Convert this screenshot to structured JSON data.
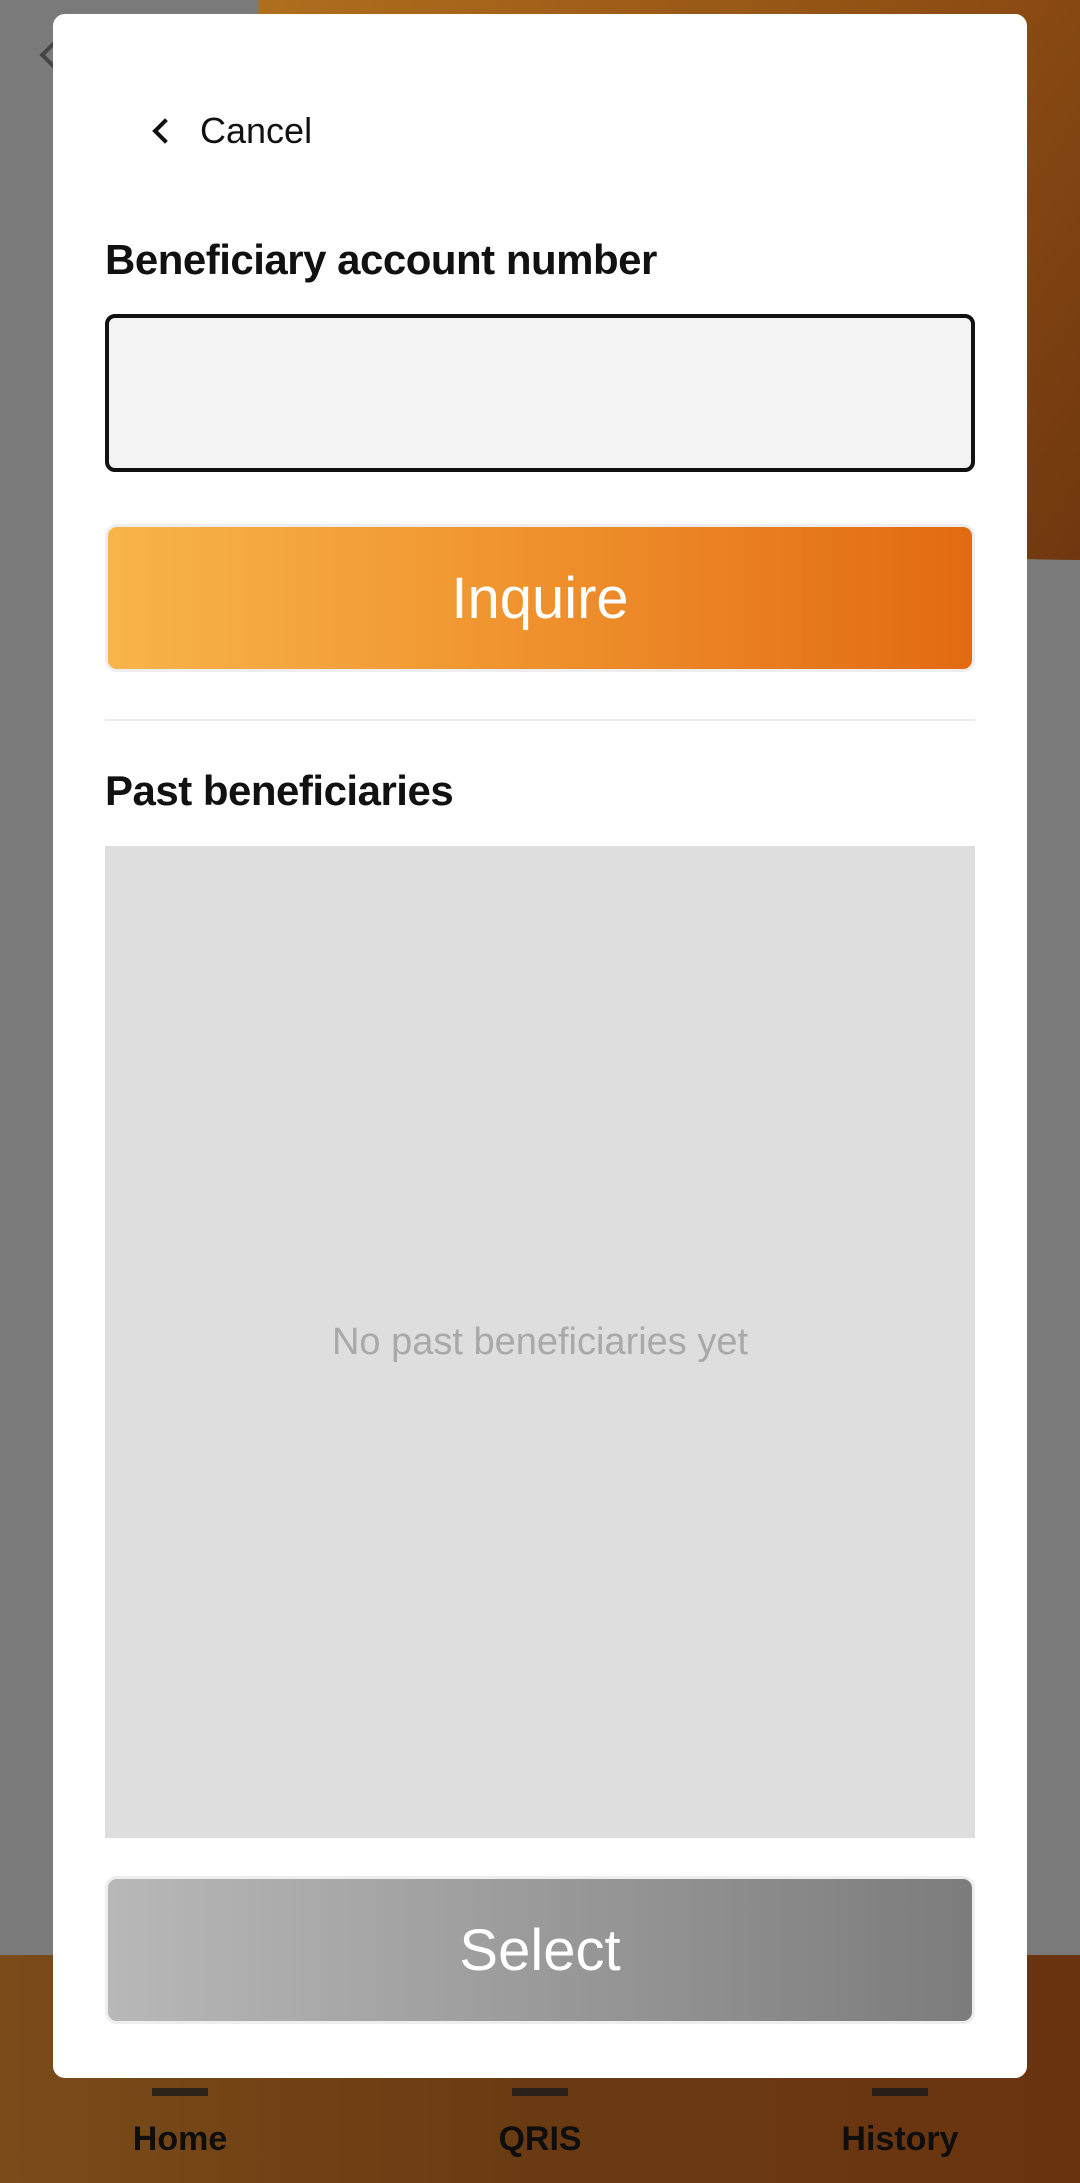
{
  "background": {
    "bottom_nav": {
      "items": [
        {
          "label": "Home"
        },
        {
          "label": "QRIS"
        },
        {
          "label": "History"
        }
      ]
    }
  },
  "modal": {
    "cancel_label": "Cancel",
    "account_label": "Beneficiary account number",
    "account_input_value": "",
    "inquire_label": "Inquire",
    "past_label": "Past beneficiaries",
    "past_empty_text": "No past beneficiaries yet",
    "select_label": "Select"
  },
  "colors": {
    "inquire_gradient_start": "#f8b44b",
    "inquire_gradient_end": "#e26a12",
    "select_gradient_start": "#b8b8b8",
    "select_gradient_end": "#7c7c7c",
    "nav_background": "#6a3a12"
  }
}
